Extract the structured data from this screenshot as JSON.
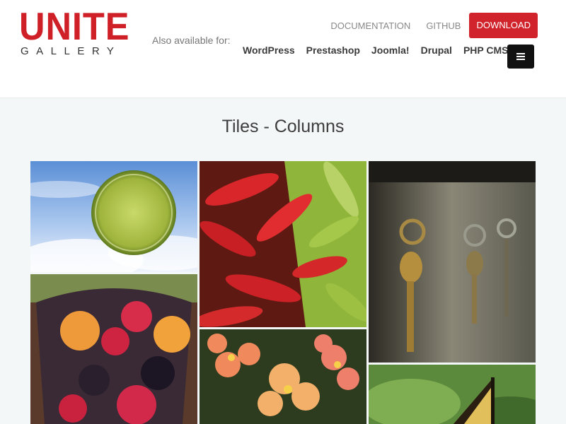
{
  "logo": {
    "main": "UNITE",
    "sub": "GALLERY"
  },
  "also": "Also available for:",
  "platforms": [
    "WordPress",
    "Prestashop",
    "Joomla!",
    "Drupal",
    "PHP CMS"
  ],
  "nav": {
    "doc": "DOCUMENTATION",
    "github": "GITHUB",
    "download": "DOWNLOAD"
  },
  "menu_icon": "menu-icon",
  "title": "Tiles - Columns",
  "colors": {
    "brand_red": "#cf1f27",
    "download_bg": "#d0232b",
    "menu_bg": "#111111"
  },
  "tiles": [
    "lime",
    "fruit-bowl",
    "peppers",
    "flowers",
    "keys",
    "butterfly"
  ]
}
